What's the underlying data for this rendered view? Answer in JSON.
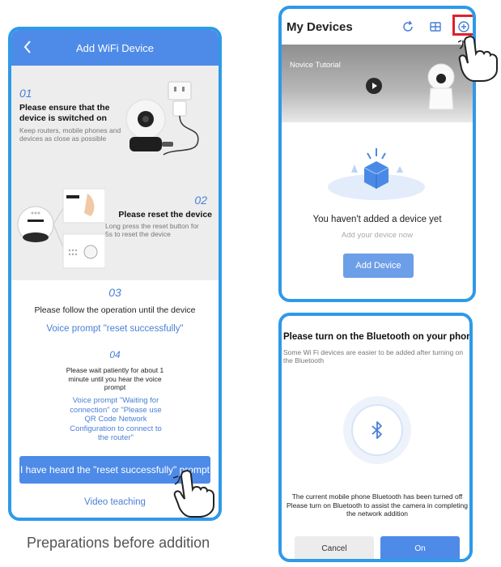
{
  "add_wifi": {
    "header_title": "Add WiFi Device",
    "step1": {
      "num": "01",
      "title": "Please ensure that the device is switched on",
      "desc": "Keep routers, mobile phones and devices as close as possible"
    },
    "step2": {
      "num": "02",
      "title": "Please reset the device",
      "desc": "Long press the reset button for 5s to reset the device"
    },
    "step3": {
      "num": "03",
      "text": "Please follow the operation until the device",
      "voice": "Voice prompt \"reset successfully\""
    },
    "step4": {
      "num": "04",
      "text": "Please wait patiently for about 1 minute until you hear the voice prompt",
      "voice": "Voice prompt \"Waiting for connection\" or \"Please use QR Code Network Configuration to connect to the router\""
    },
    "heard_button": "I have heard the \"reset successfully\" prompt",
    "video_link": "Video teaching"
  },
  "caption": "Preparations before addition",
  "my_devices": {
    "title": "My Devices",
    "banner_label": "Novice Tutorial",
    "empty_title": "You haven't added a device yet",
    "empty_sub": "Add your device now",
    "add_button": "Add Device"
  },
  "bluetooth": {
    "title": "Please turn on the Bluetooth on your phone",
    "subtitle": "Some Wi Fi devices are easier to be added after turning on the Bluetooth",
    "message": "The current mobile phone Bluetooth has been turned off\nPlease turn on Bluetooth to assist the camera in completing the network addition",
    "cancel": "Cancel",
    "on": "On"
  },
  "colors": {
    "frame": "#2e9ae8",
    "header_blue": "#4e8be8",
    "link_blue": "#4a7fd6",
    "highlight_red": "#e0202a"
  },
  "icons": [
    "back-icon",
    "refresh-icon",
    "grid-icon",
    "add-circle-icon",
    "play-icon",
    "bluetooth-icon",
    "pointing-hand-icon"
  ]
}
